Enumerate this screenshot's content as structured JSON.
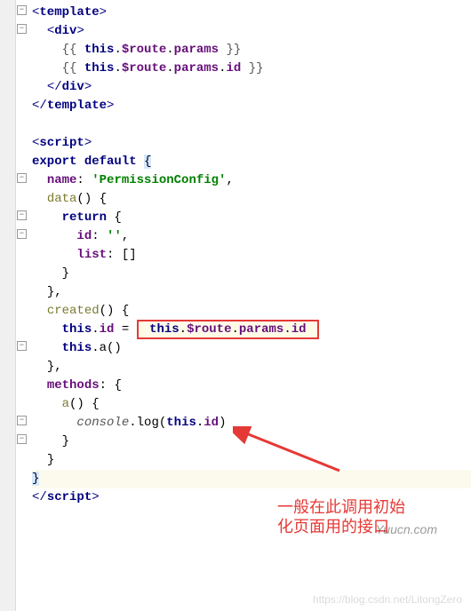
{
  "code": {
    "l1": {
      "open": "<",
      "tag": "template",
      "close": ">"
    },
    "l2": {
      "open": "<",
      "tag": "div",
      "close": ">"
    },
    "l3": {
      "m_open": "{{ ",
      "expr_this": "this",
      "dot1": ".",
      "p1": "$route",
      "dot2": ".",
      "p2": "params",
      "m_close": " }}"
    },
    "l4": {
      "m_open": "{{ ",
      "expr_this": "this",
      "dot1": ".",
      "p1": "$route",
      "dot2": ".",
      "p2": "params",
      "dot3": ".",
      "p3": "id",
      "m_close": " }}"
    },
    "l5": {
      "open": "</",
      "tag": "div",
      "close": ">"
    },
    "l6": {
      "open": "</",
      "tag": "template",
      "close": ">"
    },
    "l8": {
      "open": "<",
      "tag": "script",
      "close": ">"
    },
    "l9": {
      "kw1": "export ",
      "kw2": "default ",
      "brace": "{"
    },
    "l10": {
      "key": "name",
      "colon": ": ",
      "str": "'PermissionConfig'",
      "comma": ","
    },
    "l11": {
      "name": "data",
      "paren": "() ",
      "brace": "{"
    },
    "l12": {
      "kw": "return ",
      "brace": "{"
    },
    "l13": {
      "key": "id",
      "colon": ": ",
      "val": "''",
      "comma": ","
    },
    "l14": {
      "key": "list",
      "colon": ": ",
      "val": "[]"
    },
    "l15": {
      "brace": "}"
    },
    "l16": {
      "brace": "}",
      "comma": ","
    },
    "l17": {
      "name": "created",
      "paren": "() ",
      "brace": "{"
    },
    "l18": {
      "this": "this",
      "dot1": ".",
      "prop": "id",
      "eq": " = ",
      "this2": "this",
      "dot2": ".",
      "p1": "$route",
      "dot3": ".",
      "p2": "params",
      "dot4": ".",
      "p3": "id"
    },
    "l19": {
      "this": "this",
      "dot": ".",
      "method": "a",
      "paren": "()"
    },
    "l20": {
      "brace": "}",
      "comma": ","
    },
    "l21": {
      "key": "methods",
      "colon": ": ",
      "brace": "{"
    },
    "l22": {
      "name": "a",
      "paren": "() ",
      "brace": "{"
    },
    "l23": {
      "console": "console",
      "dot": ".",
      "log": "log",
      "open": "(",
      "this": "this",
      "dot2": ".",
      "prop": "id",
      "close": ")"
    },
    "l24": {
      "brace": "}"
    },
    "l25": {
      "brace": "}"
    },
    "l26": {
      "brace": "}"
    },
    "l27": {
      "open": "</",
      "tag": "script",
      "close": ">"
    }
  },
  "annotation": {
    "line1": "一般在此调用初始",
    "line2": "化页面用的接口"
  },
  "watermark": {
    "yuucn": "Yuucn.com",
    "csdn": "https://blog.csdn.net/LitongZero"
  },
  "fold_minus": "−"
}
